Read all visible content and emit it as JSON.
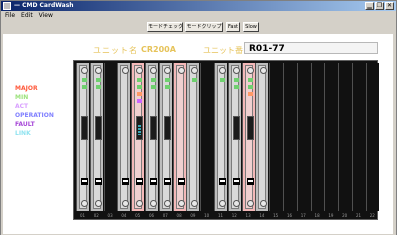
{
  "window": {
    "title": "— CMD CardWash",
    "controls": [
      "▁",
      "❐",
      "✕"
    ]
  },
  "menu": [
    "File",
    "Edit",
    "View"
  ],
  "toolbar": {
    "btn1": "モードチェック",
    "btn2": "モードクリップ",
    "btn3": "Fast",
    "btn4": "Slow"
  },
  "header": {
    "label": "ユニット名",
    "model": "CR200A",
    "unit_label": "ユニット番",
    "unit_value": "R01-77"
  },
  "legend": [
    {
      "text": "MAJOR",
      "color": "#ff5a3c"
    },
    {
      "text": "MIN",
      "color": "#9be27b"
    },
    {
      "text": "ACT",
      "color": "#d9a0ff"
    },
    {
      "text": "OPERATION",
      "color": "#8080ff"
    },
    {
      "text": "FAULT",
      "color": "#a84ad8"
    },
    {
      "text": "LINK",
      "color": "#8fe3f0"
    }
  ],
  "slots": [
    {
      "type": "card",
      "leds": [
        "#6fd06f",
        "#6fd06f"
      ],
      "port": "plain",
      "tab": true
    },
    {
      "type": "card",
      "leds": [
        "#6fd06f",
        "#6fd06f"
      ],
      "port": "plain",
      "tab": true
    },
    {
      "type": "empty"
    },
    {
      "type": "card",
      "leds": [],
      "port": "none",
      "tab": true
    },
    {
      "type": "pink",
      "leds": [
        "#6fd06f",
        "#6fd06f",
        "#ff9966",
        "#cc66ff"
      ],
      "port": "cyan",
      "tab": true
    },
    {
      "type": "card",
      "leds": [
        "#6fd06f",
        "#6fd06f"
      ],
      "port": "plain",
      "tab": true
    },
    {
      "type": "card",
      "leds": [
        "#6fd06f",
        "#6fd06f"
      ],
      "port": "plain",
      "tab": true
    },
    {
      "type": "pink",
      "leds": [],
      "port": "none",
      "tab": true
    },
    {
      "type": "card",
      "leds": [
        "#6fd06f"
      ],
      "port": "none",
      "tab": false
    },
    {
      "type": "empty"
    },
    {
      "type": "card",
      "leds": [
        "#6fd06f"
      ],
      "port": "none",
      "tab": true
    },
    {
      "type": "card",
      "leds": [
        "#6fd06f",
        "#6fd06f"
      ],
      "port": "plain",
      "tab": true
    },
    {
      "type": "pink",
      "leds": [
        "#6fd06f",
        "#6fd06f",
        "#ff9966"
      ],
      "port": "plain",
      "tab": true
    },
    {
      "type": "card",
      "leds": [],
      "port": "none",
      "tab": false
    },
    {
      "type": "empty"
    },
    {
      "type": "empty"
    },
    {
      "type": "empty"
    },
    {
      "type": "empty"
    },
    {
      "type": "empty"
    },
    {
      "type": "empty"
    },
    {
      "type": "empty"
    },
    {
      "type": "empty"
    }
  ],
  "slot_numbers": [
    "01",
    "02",
    "03",
    "04",
    "05",
    "06",
    "07",
    "08",
    "09",
    "10",
    "11",
    "12",
    "13",
    "14",
    "15",
    "16",
    "17",
    "18",
    "19",
    "20",
    "21",
    "22"
  ]
}
